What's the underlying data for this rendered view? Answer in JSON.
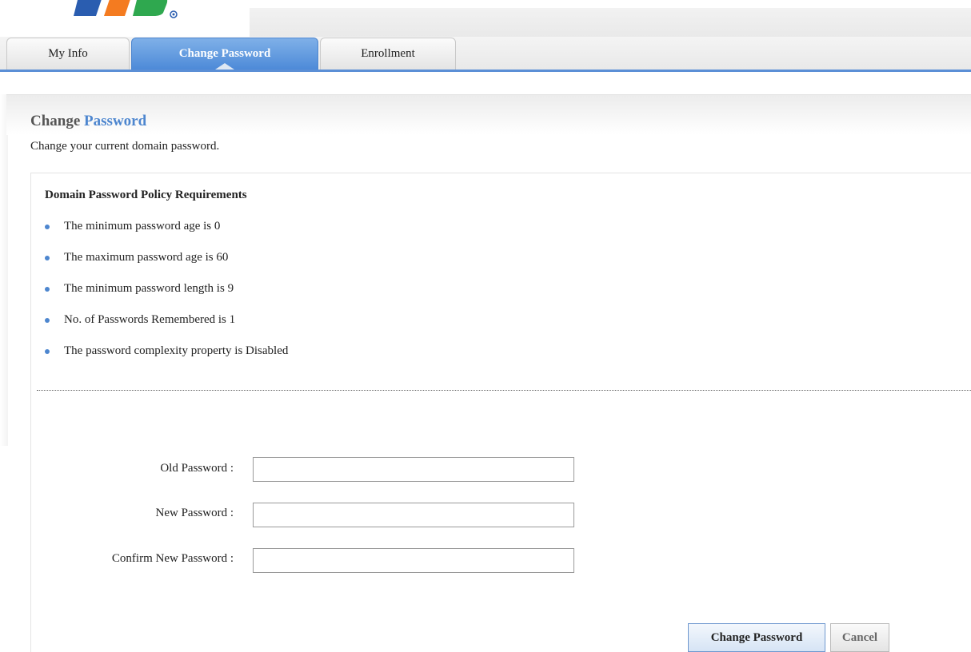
{
  "tabs": [
    {
      "label": "My Info",
      "active": false
    },
    {
      "label": "Change Password",
      "active": true
    },
    {
      "label": "Enrollment",
      "active": false
    }
  ],
  "page": {
    "title_part1": "Change",
    "title_part2": "Password",
    "description": "Change your current domain password."
  },
  "policy": {
    "heading": "Domain Password Policy Requirements",
    "items": [
      "The minimum password age is 0",
      "The maximum password age is 60",
      "The minimum password length is 9",
      "No. of Passwords Remembered is 1",
      "The password complexity property is Disabled"
    ]
  },
  "form": {
    "old_password_label": "Old Password :",
    "new_password_label": "New Password :",
    "confirm_password_label": "Confirm New Password :",
    "old_password_value": "",
    "new_password_value": "",
    "confirm_password_value": ""
  },
  "buttons": {
    "submit": "Change Password",
    "cancel": "Cancel"
  },
  "colors": {
    "accent": "#4d86cf",
    "tab_active": "#5b8fd6"
  },
  "icons": {
    "logo": "brand-logo"
  }
}
